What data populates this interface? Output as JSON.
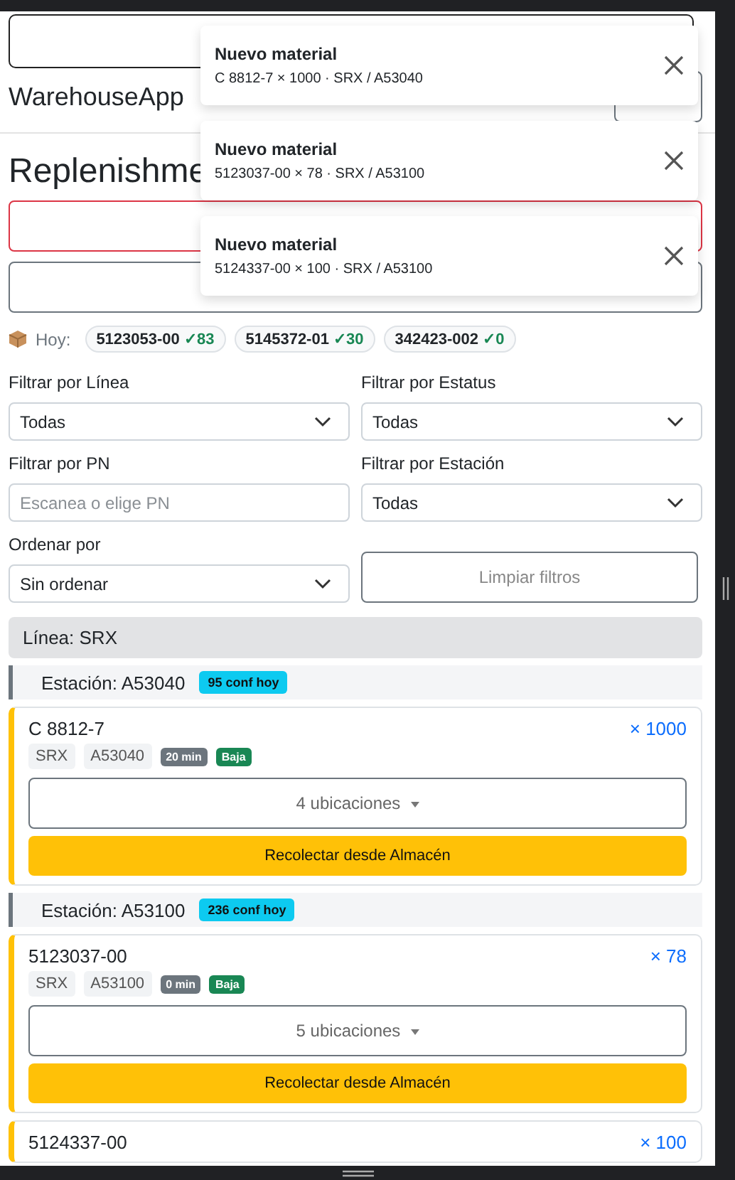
{
  "navbar": {
    "brand": "WarehouseApp"
  },
  "title": "Replenishme",
  "buttons": [
    {
      "kind": "danger"
    },
    {
      "kind": "secondary"
    }
  ],
  "today": {
    "label": "Hoy:",
    "items": [
      {
        "pn": "5123053-00",
        "count": "✓83"
      },
      {
        "pn": "5145372-01",
        "count": "✓30"
      },
      {
        "pn": "342423-002",
        "count": "✓0"
      }
    ]
  },
  "filters": [
    {
      "kind": "select",
      "label": "Filtrar por Línea",
      "value": "Todas"
    },
    {
      "kind": "select",
      "label": "Filtrar por Estatus",
      "value": "Todas"
    },
    {
      "kind": "input",
      "label": "Filtrar por PN",
      "placeholder": "Escanea o elige PN"
    },
    {
      "kind": "select",
      "label": "Filtrar por Estación",
      "value": "Todas"
    },
    {
      "kind": "select",
      "label": "Ordenar por",
      "value": "Sin ordenar"
    },
    {
      "kind": "button",
      "label": "Limpiar filtros"
    }
  ],
  "lines": [
    {
      "title": "Línea: SRX",
      "stations": [
        {
          "title": "Estación: A53040",
          "badge": "95 conf hoy",
          "requests": [
            {
              "pn": "C 8812-7",
              "qty": "× 1000",
              "line": "SRX",
              "station": "A53040",
              "age": "20 min",
              "priority": "Baja",
              "locations": "4 ubicaciones",
              "action": "Recolectar desde Almacén"
            }
          ]
        },
        {
          "title": "Estación: A53100",
          "badge": "236 conf hoy",
          "requests": [
            {
              "pn": "5123037-00",
              "qty": "× 78",
              "line": "SRX",
              "station": "A53100",
              "age": "0 min",
              "priority": "Baja",
              "locations": "5 ubicaciones",
              "action": "Recolectar desde Almacén"
            },
            {
              "pn": "5124337-00",
              "qty": "× 100"
            }
          ]
        }
      ]
    }
  ],
  "toasts": [
    {
      "title": "Nuevo material",
      "body": "C 8812-7 × 1000 · SRX / A53040"
    },
    {
      "title": "Nuevo material",
      "body": "5123037-00 × 78 · SRX / A53100"
    },
    {
      "title": "Nuevo material",
      "body": "5124337-00 × 100 · SRX / A53100"
    }
  ]
}
